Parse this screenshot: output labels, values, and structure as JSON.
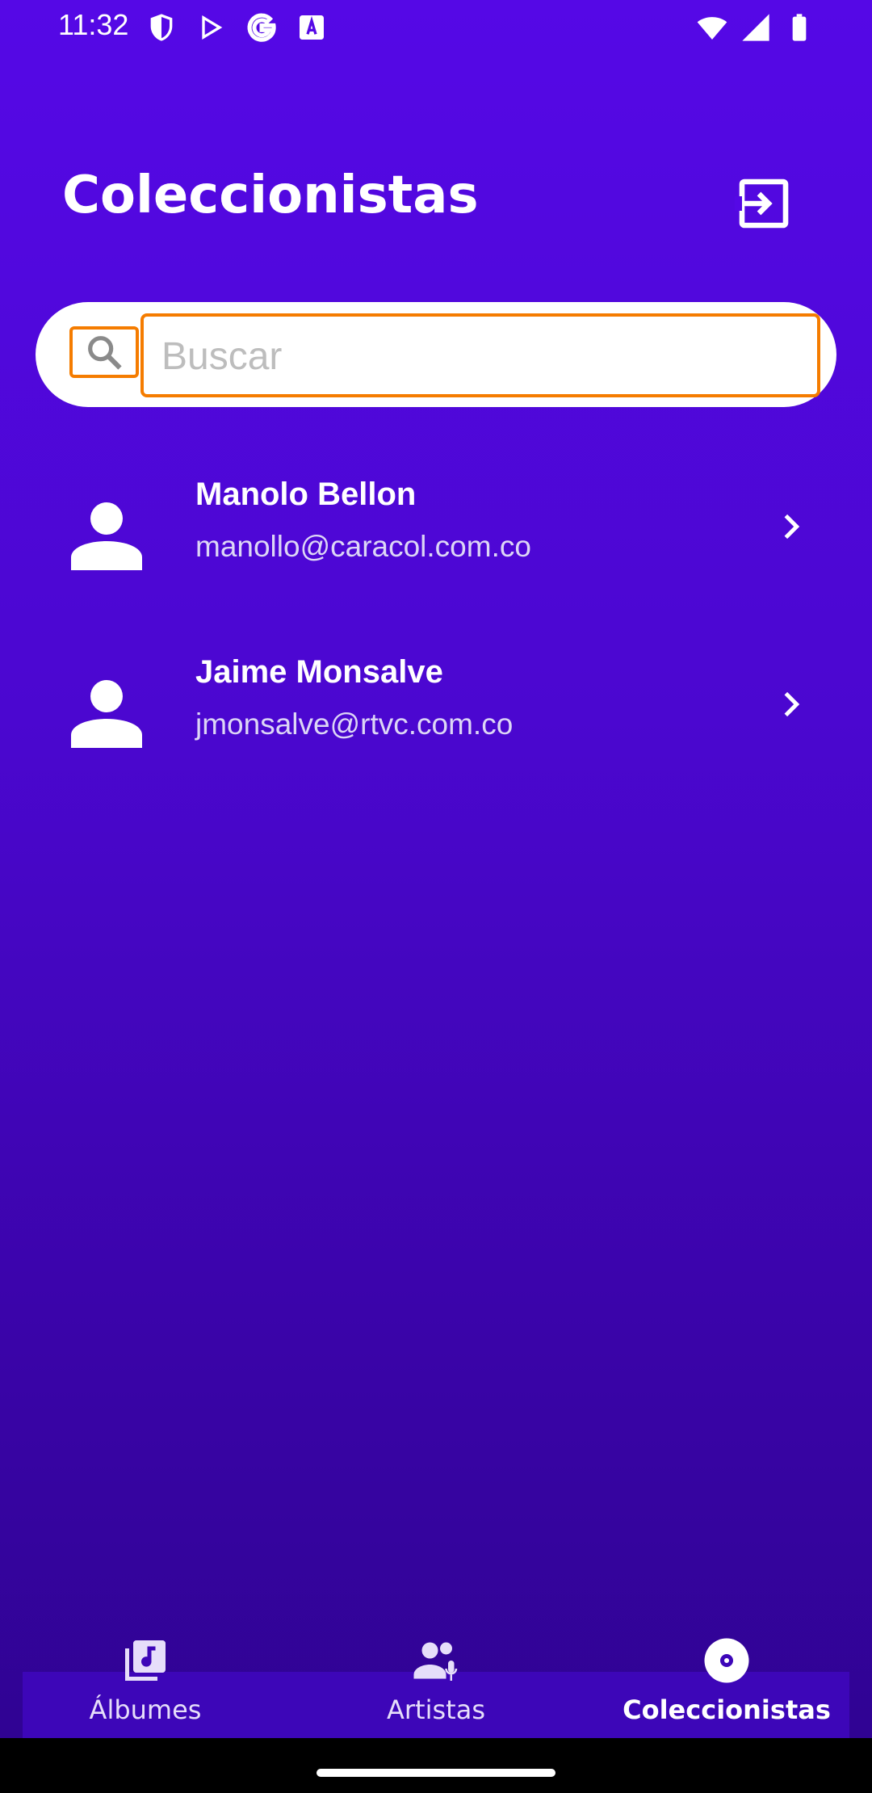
{
  "status_bar": {
    "time": "11:32",
    "left_icons": [
      "shield-icon",
      "play-store-icon",
      "google-icon",
      "font-icon"
    ],
    "right_icons": [
      "wifi-icon",
      "cell-signal-icon",
      "battery-icon"
    ]
  },
  "header": {
    "title": "Coleccionistas",
    "logout_icon": "logout-icon"
  },
  "search": {
    "placeholder": "Buscar",
    "value": ""
  },
  "collectors": [
    {
      "name": "Manolo Bellon",
      "email": "manollo@caracol.com.co"
    },
    {
      "name": "Jaime Monsalve",
      "email": "jmonsalve@rtvc.com.co"
    }
  ],
  "bottom_nav": {
    "items": [
      {
        "label": "Álbumes",
        "icon": "album-library-icon",
        "active": false
      },
      {
        "label": "Artistas",
        "icon": "artists-icon",
        "active": false
      },
      {
        "label": "Coleccionistas",
        "icon": "vinyl-disc-icon",
        "active": true
      }
    ]
  },
  "colors": {
    "background_top": "#5508e6",
    "background_bottom": "#2e0390",
    "highlight": "#f57c00"
  }
}
